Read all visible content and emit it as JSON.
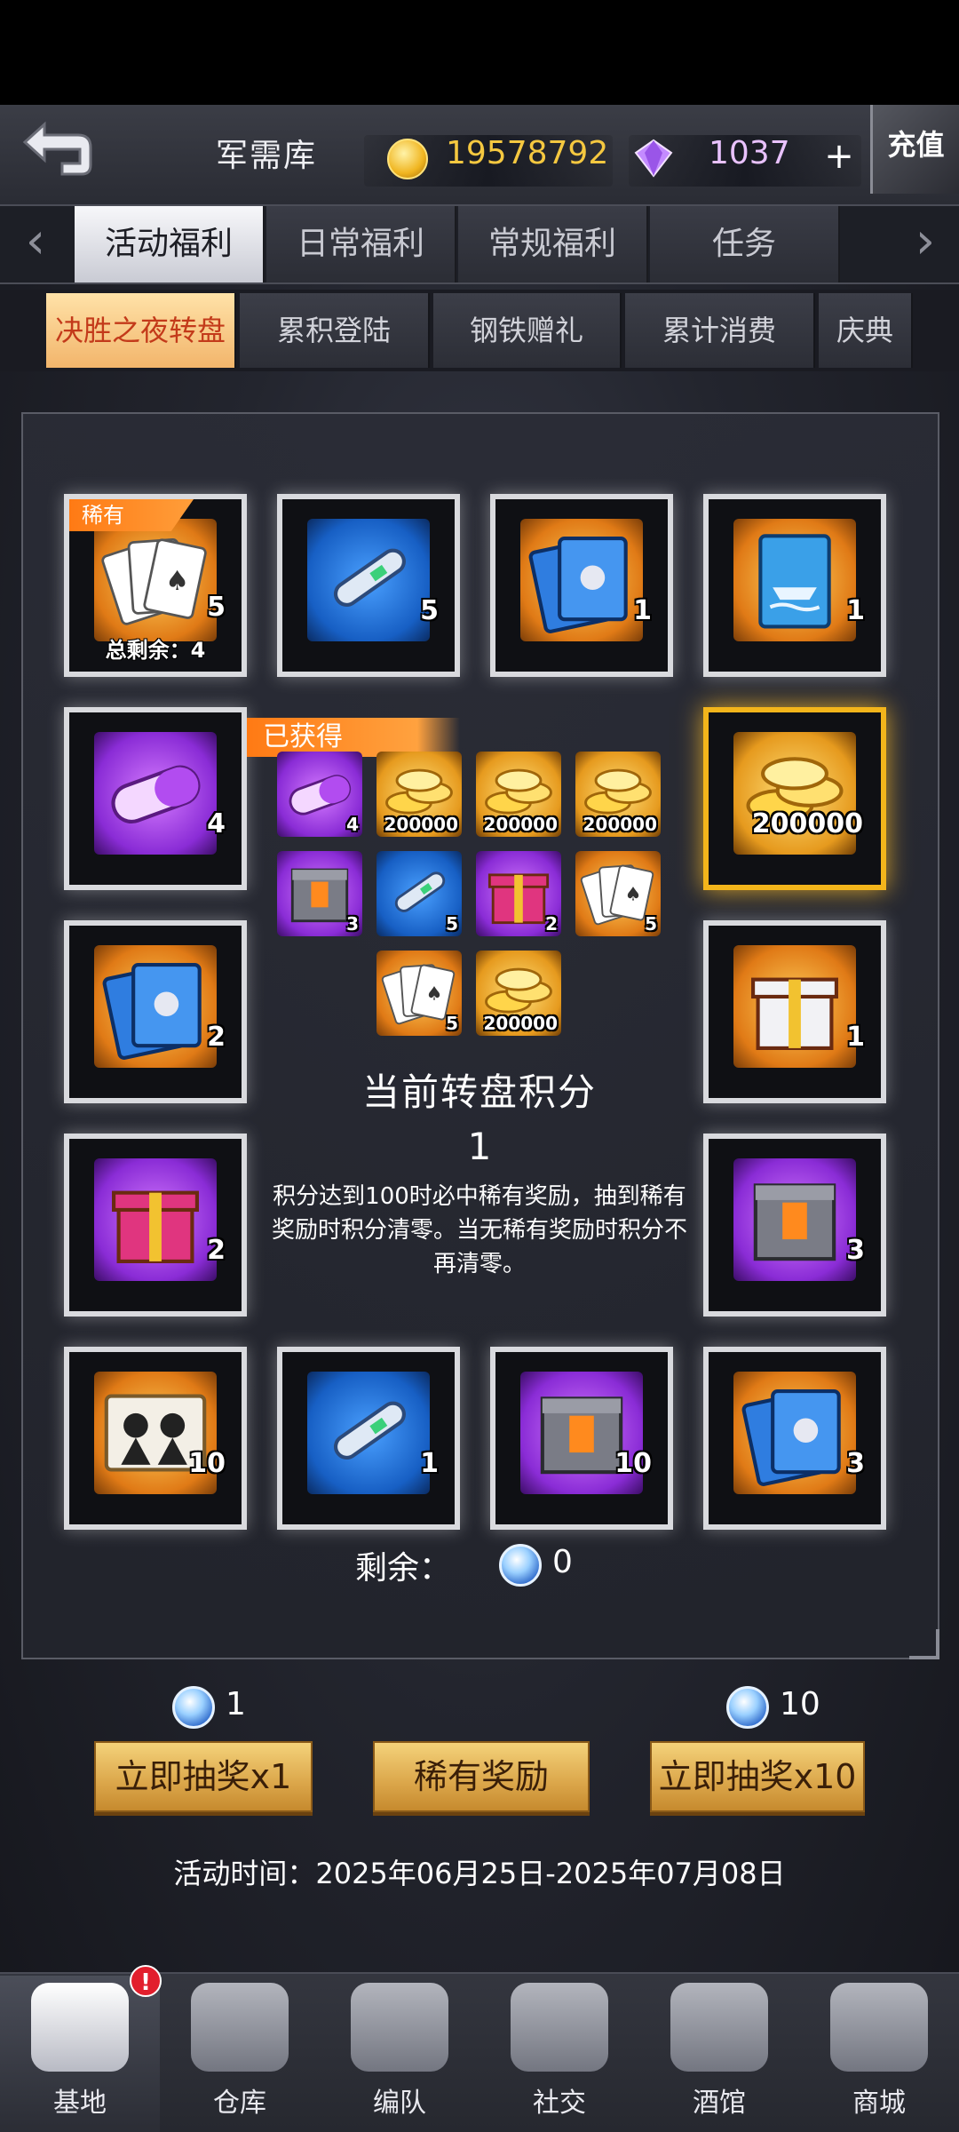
{
  "header": {
    "title": "军需库",
    "coins": "19578792",
    "gems": "1037",
    "plus": "+",
    "recharge_label": "充值"
  },
  "tabs": [
    {
      "label": "活动福利",
      "active": true
    },
    {
      "label": "日常福利",
      "active": false
    },
    {
      "label": "常规福利",
      "active": false
    },
    {
      "label": "任务",
      "active": false
    }
  ],
  "subtabs": [
    {
      "label": "决胜之夜转盘",
      "active": true
    },
    {
      "label": "累积登陆",
      "active": false
    },
    {
      "label": "钢铁赠礼",
      "active": false
    },
    {
      "label": "累计消费",
      "active": false
    },
    {
      "label": "庆典",
      "active": false
    }
  ],
  "wheel": {
    "slots": [
      {
        "icon": "playing-cards-icon",
        "bg": "orange",
        "count": "5",
        "rare_tag": "稀有",
        "remain_label": "总剩余：4"
      },
      {
        "icon": "pen-icon",
        "bg": "blue",
        "count": "5"
      },
      {
        "icon": "blue-cards-icon",
        "bg": "orange",
        "count": "1"
      },
      {
        "icon": "ship-card-icon",
        "bg": "orange",
        "count": "1"
      },
      {
        "icon": "capsule-icon",
        "bg": "purple",
        "count": "4"
      },
      {
        "icon": "gold-coins-icon",
        "bg": "gold",
        "count": "200000",
        "selected": true
      },
      {
        "icon": "blue-cards-icon",
        "bg": "orange",
        "count": "2"
      },
      {
        "icon": "gift-box-icon",
        "bg": "orange",
        "count": "1"
      },
      {
        "icon": "pink-gift-icon",
        "bg": "purple",
        "count": "2"
      },
      {
        "icon": "crate-icon",
        "bg": "purple",
        "count": "3"
      },
      {
        "icon": "character-cards-icon",
        "bg": "orange",
        "count": "10"
      },
      {
        "icon": "pen-icon",
        "bg": "blue",
        "count": "1"
      },
      {
        "icon": "crate-icon",
        "bg": "purple",
        "count": "10"
      },
      {
        "icon": "blue-cards-icon",
        "bg": "orange",
        "count": "3"
      }
    ],
    "obtained_label": "已获得",
    "obtained": [
      {
        "icon": "capsule-icon",
        "bg": "purple",
        "count": "4"
      },
      {
        "icon": "gold-coins-icon",
        "bg": "gold",
        "count": "200000"
      },
      {
        "icon": "gold-coins-icon",
        "bg": "gold",
        "count": "200000"
      },
      {
        "icon": "gold-coins-icon",
        "bg": "gold",
        "count": "200000"
      },
      {
        "icon": "crate-icon",
        "bg": "purple",
        "count": "3"
      },
      {
        "icon": "pen-icon",
        "bg": "blue",
        "count": "5"
      },
      {
        "icon": "pink-gift-icon",
        "bg": "purple",
        "count": "2"
      },
      {
        "icon": "playing-cards-icon",
        "bg": "orange",
        "count": "5"
      },
      {
        "icon": "playing-cards-icon",
        "bg": "orange",
        "count": "5"
      },
      {
        "icon": "gold-coins-icon",
        "bg": "gold",
        "count": "200000"
      }
    ],
    "score_title": "当前转盘积分",
    "score_value": "1",
    "score_desc": "积分达到100时必中稀有奖励，抽到稀有奖励时积分清零。当无稀有奖励时积分不再清零。",
    "remaining_label": "剩余：",
    "remaining_value": "0"
  },
  "actions": {
    "cost_single": "1",
    "cost_ten": "10",
    "draw_one": "立即抽奖x1",
    "rare_reward": "稀有奖励",
    "draw_ten": "立即抽奖x10"
  },
  "activity_time": "活动时间：2025年06月25日-2025年07月08日",
  "nav": [
    {
      "label": "基地",
      "icon": "base-star-icon",
      "active": true,
      "badge": "!"
    },
    {
      "label": "仓库",
      "icon": "warehouse-icon",
      "active": false
    },
    {
      "label": "编队",
      "icon": "formation-helmet-icon",
      "active": false
    },
    {
      "label": "社交",
      "icon": "handshake-icon",
      "active": false
    },
    {
      "label": "酒馆",
      "icon": "tavern-icon",
      "active": false
    },
    {
      "label": "商城",
      "icon": "shop-icon",
      "active": false
    }
  ]
}
